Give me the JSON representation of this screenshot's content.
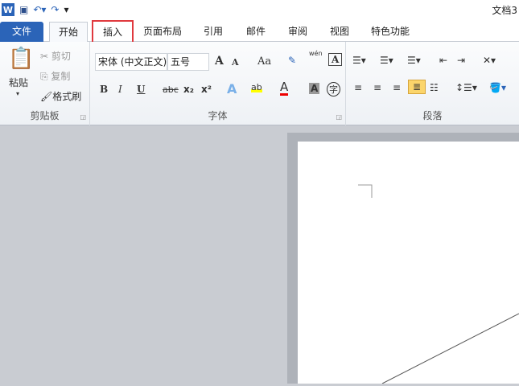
{
  "window": {
    "title": "文档3"
  },
  "qat": {
    "customize": "▾"
  },
  "tabs": [
    "文件",
    "开始",
    "插入",
    "页面布局",
    "引用",
    "邮件",
    "审阅",
    "视图",
    "特色功能"
  ],
  "clipboard": {
    "label": "剪贴板",
    "paste": "粘贴",
    "cut": "剪切",
    "copy": "复制",
    "format_painter": "格式刷"
  },
  "font": {
    "label": "字体",
    "name": "宋体 (中文正文)",
    "size": "五号",
    "bold": "B",
    "italic": "I",
    "underline": "U",
    "strike": "abc",
    "sub": "x₂",
    "sup": "x²",
    "case": "Aa",
    "grow": "A",
    "shrink": "A",
    "text_effect": "A",
    "highlight": "ab",
    "color": "A",
    "shade": "A",
    "circle": "字",
    "wen": "wén"
  },
  "paragraph": {
    "label": "段落"
  }
}
